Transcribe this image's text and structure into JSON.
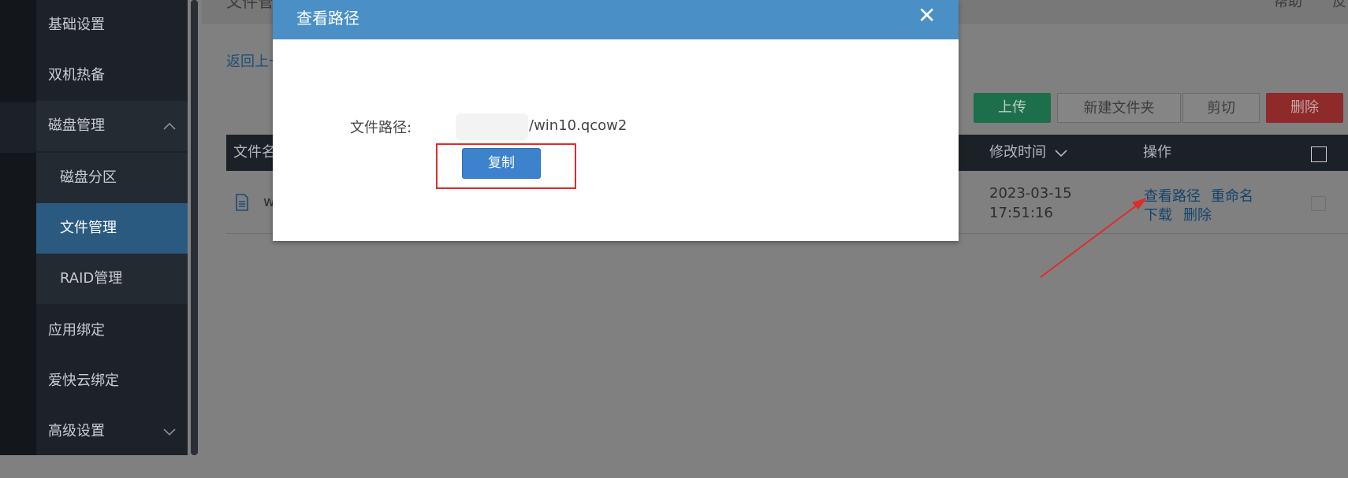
{
  "sidebar": {
    "items": [
      {
        "label": "基础设置"
      },
      {
        "label": "双机热备"
      },
      {
        "label": "磁盘管理"
      },
      {
        "label": "磁盘分区"
      },
      {
        "label": "文件管理"
      },
      {
        "label": "RAID管理"
      },
      {
        "label": "应用绑定"
      },
      {
        "label": "爱快云绑定"
      },
      {
        "label": "高级设置"
      }
    ],
    "chevron_up": "^",
    "chevron_down": "∨"
  },
  "page": {
    "title": "文件管",
    "top_right_1": "帮助",
    "top_right_2": "反",
    "back_link": "返回上一"
  },
  "toolbar": {
    "upload_label": "上传",
    "new_folder_label": "新建文件夹",
    "cut_label": "剪切",
    "delete_label": "删除"
  },
  "table": {
    "headers": {
      "name": "文件名",
      "modified": "修改时间",
      "modified_sort_icon": "∨",
      "actions": "操作"
    },
    "rows": [
      {
        "name_peek": "w",
        "date": "2023-03-15",
        "time": "17:51:16",
        "actions": {
          "view_path": "查看路径",
          "rename": "重命名",
          "download": "下载",
          "delete": "删除"
        }
      }
    ]
  },
  "modal": {
    "title": "查看路径",
    "close_glyph": "✕",
    "path_label": "文件路径:",
    "path_value": "/win10.qcow2",
    "copy_label": "复制"
  },
  "colors": {
    "modal_header": "#4a8fc6",
    "copy_button": "#3c82cd",
    "highlight_box": "#e02b2b",
    "arrow": "#e02b2b",
    "active_sidebar": "#2b5a80"
  }
}
